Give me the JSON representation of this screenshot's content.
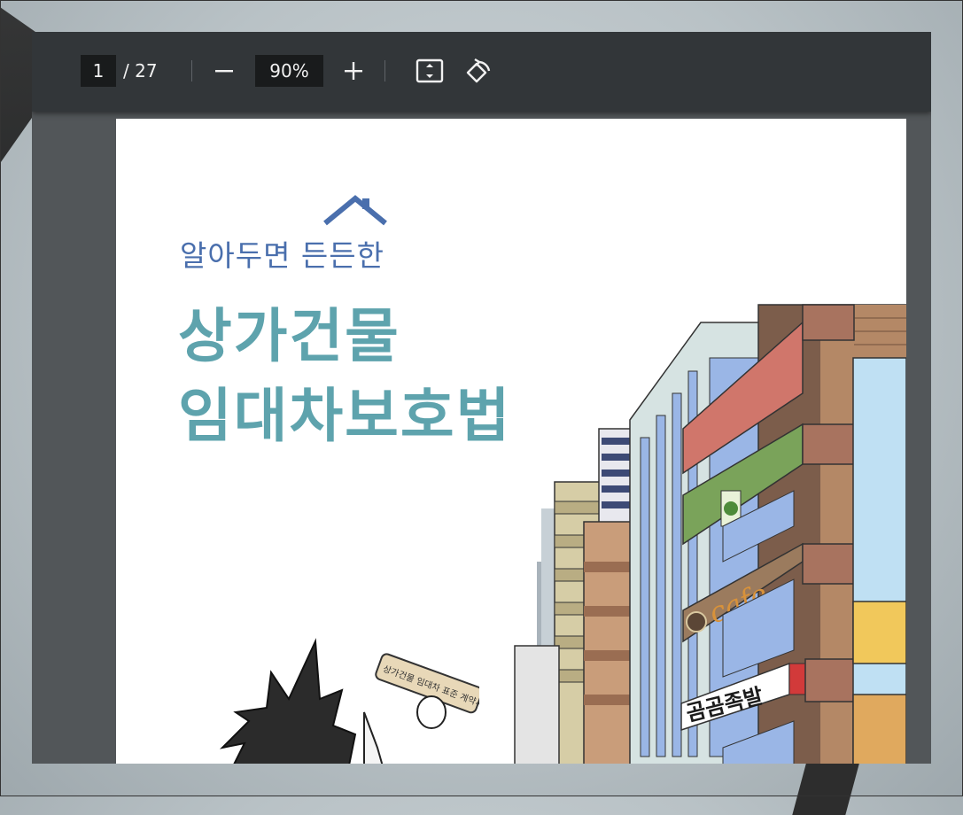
{
  "toolbar": {
    "current_page": "1",
    "total_pages": "/ 27",
    "zoom": "90%"
  },
  "document": {
    "subtitle": "알아두면 든든한",
    "title_line1": "상가건물",
    "title_line2": "임대차보호법"
  },
  "illustration": {
    "cafe_sign": "cafe",
    "shop_sign": "곰곰족발",
    "scroll_text": "상가건물 임대차 표준 계약서"
  },
  "colors": {
    "toolbar": "#323639",
    "viewer_bg": "#525659",
    "subtitle": "#4a6fad",
    "title": "#5ea3ad"
  }
}
